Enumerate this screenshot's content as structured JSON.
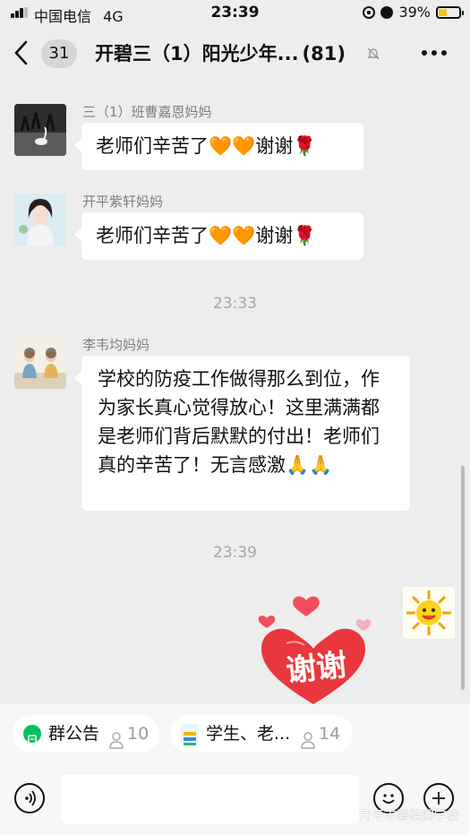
{
  "status_bar": {
    "carrier": "中国电信",
    "network": "4G",
    "time": "23:39",
    "battery": "39%"
  },
  "header": {
    "unread_count": "31",
    "title": "开碧三（1）阳光少年...",
    "member_count": "(81)"
  },
  "messages": [
    {
      "sender": "三（1）班曹嘉恩妈妈",
      "text": "老师们辛苦了🧡🧡谢谢🌹"
    },
    {
      "sender": "开平紫轩妈妈",
      "text": "老师们辛苦了🧡🧡谢谢🌹"
    },
    {
      "sender": "李韦均妈妈",
      "text": "学校的防疫工作做得那么到位，作为家长真心觉得放心！这里满满都是老师们背后默默的付出！老师们真的辛苦了！无言感激🙏🙏"
    }
  ],
  "timestamps": [
    "23:33",
    "23:39"
  ],
  "sticker": {
    "text": "谢谢"
  },
  "pinned": [
    {
      "label": "群公告",
      "count": "10"
    },
    {
      "label": "学生、老...",
      "count": "14"
    }
  ],
  "watermark": "开平市碧桂园学校",
  "colors": {
    "background": "#ededed",
    "bubble": "#ffffff",
    "heart": "#e8383d",
    "wechat_green": "#07c160"
  }
}
